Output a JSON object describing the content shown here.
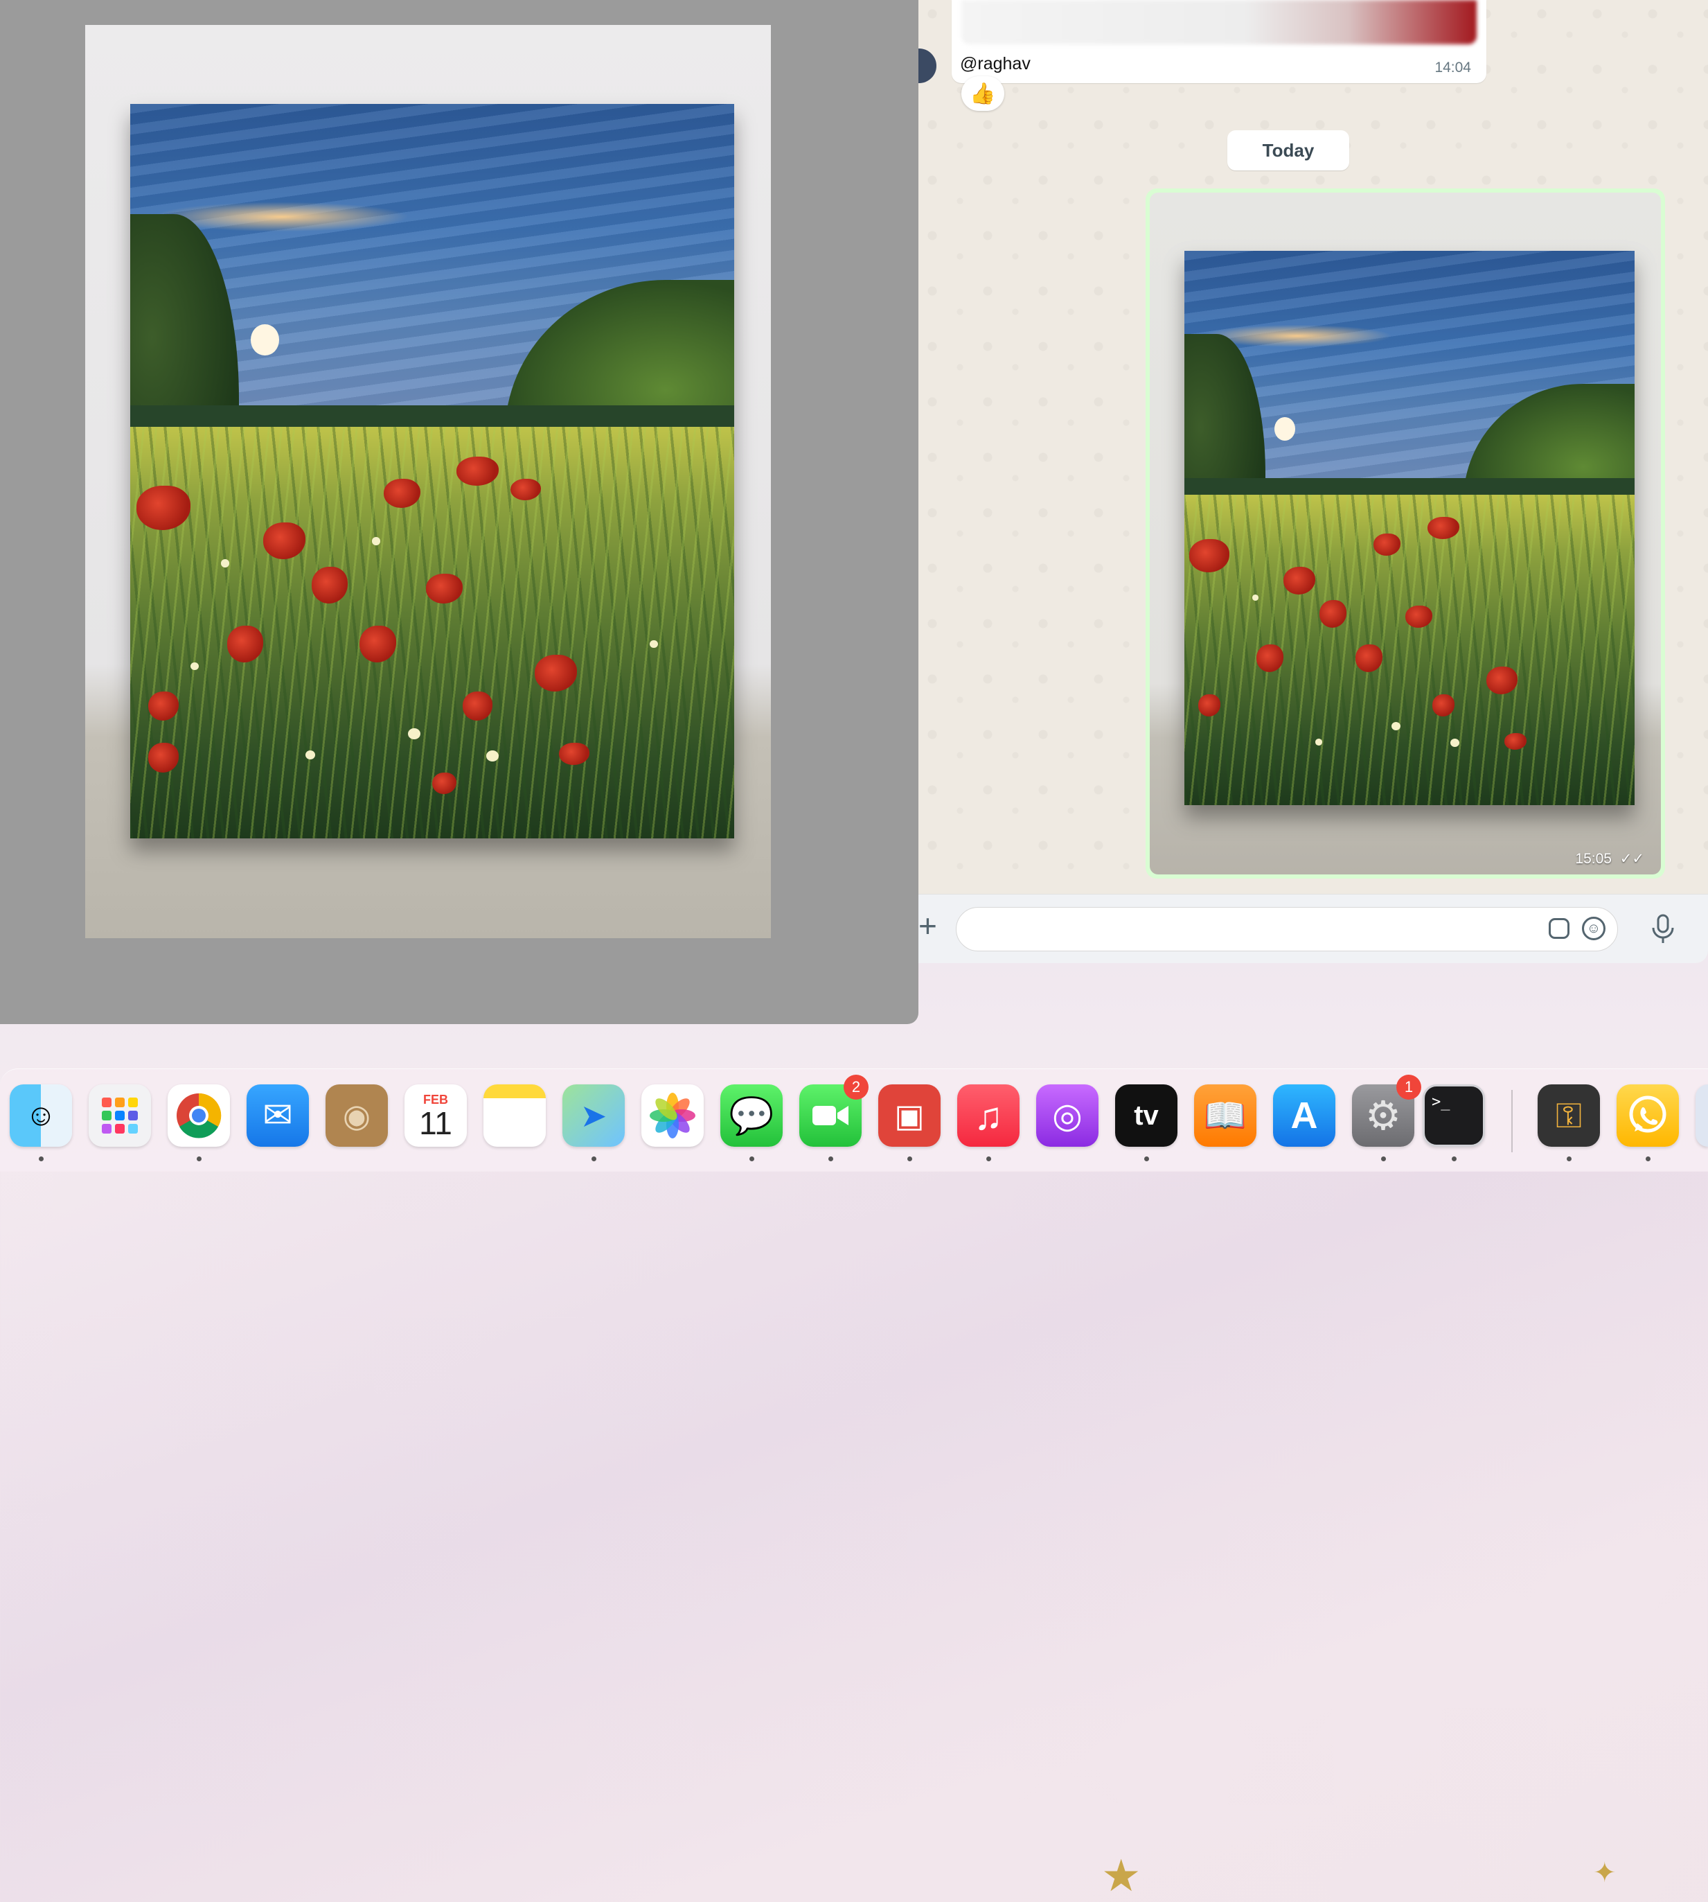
{
  "preview": {
    "image_alt": "Acrylic painting of a poppy field at sunset"
  },
  "chat": {
    "previous_message": {
      "sender": "@raghav",
      "time": "14:04",
      "reaction": "👍"
    },
    "day_separator": "Today",
    "outgoing_image_message": {
      "time": "15:05",
      "status": "✓✓"
    },
    "composer": {
      "placeholder": "",
      "attach_symbol": "+"
    }
  },
  "dock": {
    "calendar": {
      "month": "FEB",
      "day": "11"
    },
    "facetime_badge": "2",
    "settings_badge": "1",
    "terminal_prompt": ">_",
    "tv_label": "tv"
  },
  "colors": {
    "bubble_out": "#d9fdd3",
    "chat_bg": "#efeae2",
    "badge_red": "#f0453a"
  }
}
